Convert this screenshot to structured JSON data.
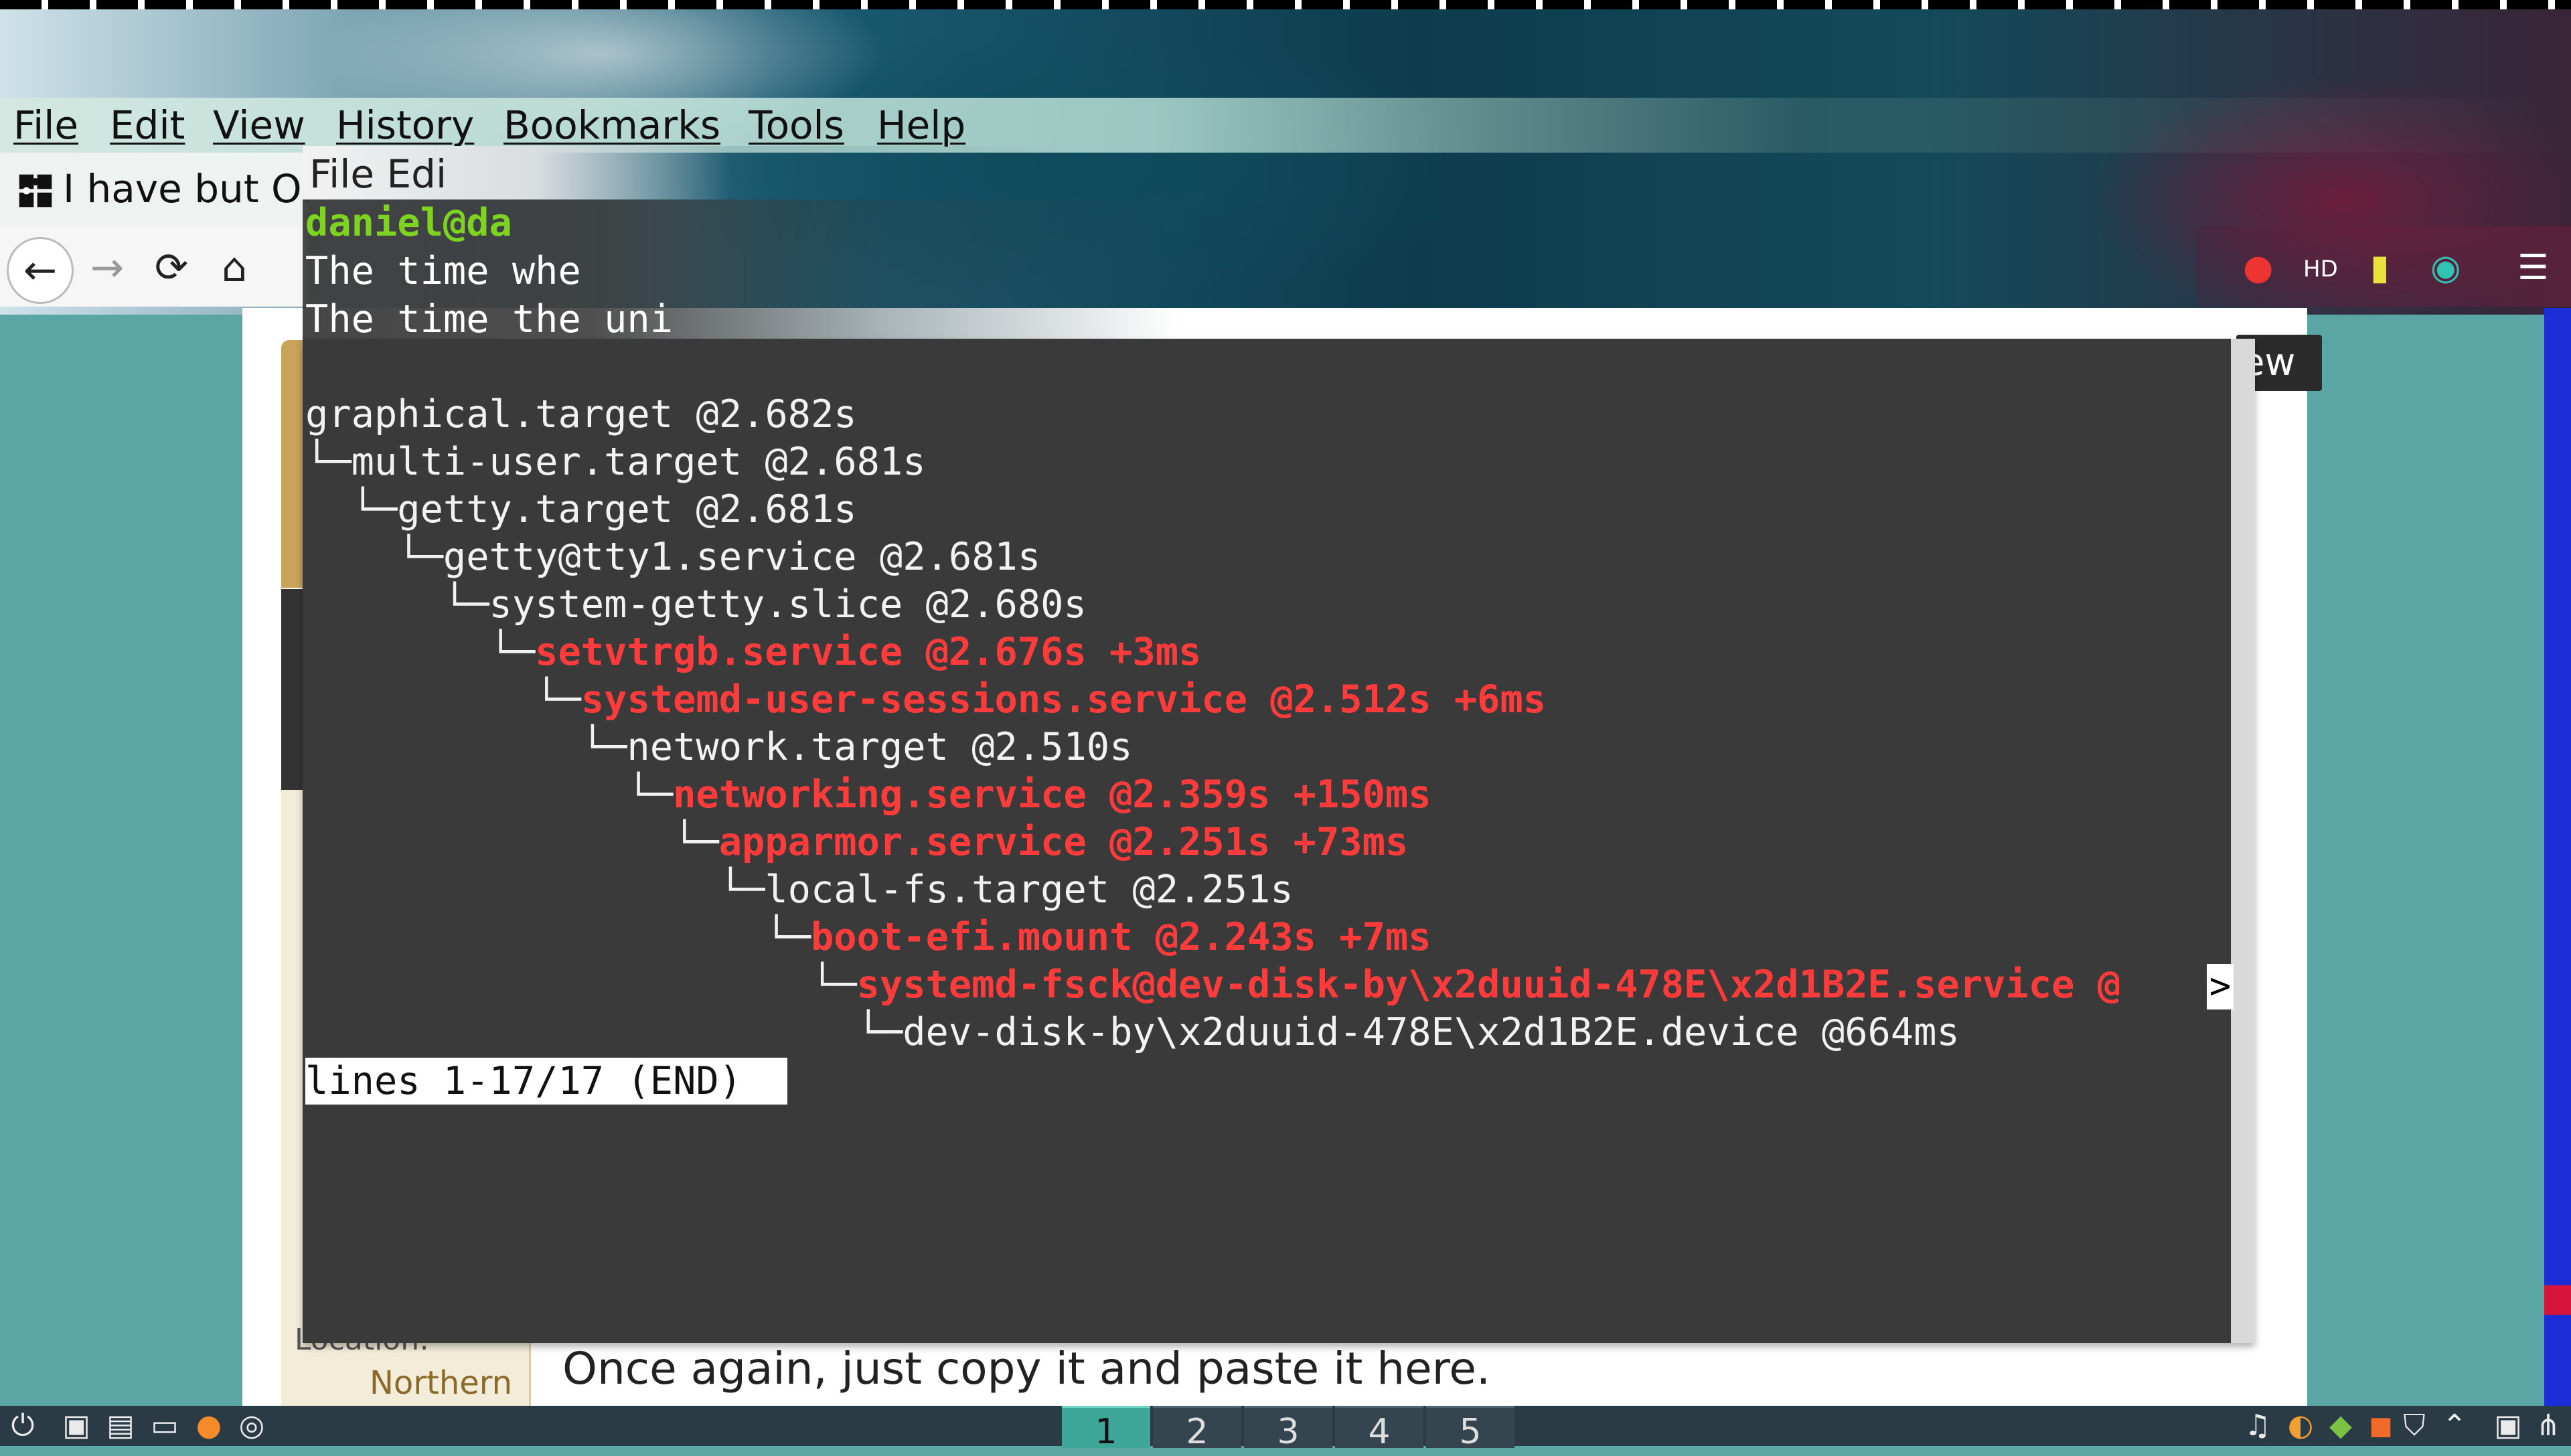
{
  "browser": {
    "menu": [
      "File",
      "Edit",
      "View",
      "History",
      "Bookmarks",
      "Tools",
      "Help"
    ],
    "tab_title": "I have but Ol",
    "new_button_label": "ew",
    "page": {
      "answer_hint": "Once again, just copy it and paste it here.",
      "location_label": "Location:",
      "location_value": "Northern"
    }
  },
  "terminal": {
    "title_menu": "File Edi",
    "prompt": "daniel@da",
    "top_lines": [
      "The time whe",
      "The time the uni"
    ],
    "lines": [
      {
        "text": "graphical.target @2.682s",
        "red": false
      },
      {
        "text": "└─multi-user.target @2.681s",
        "red": false
      },
      {
        "text": "  └─getty.target @2.681s",
        "red": false
      },
      {
        "text": "    └─getty@tty1.service @2.681s",
        "red": false
      },
      {
        "text": "      └─system-getty.slice @2.680s",
        "red": false
      },
      {
        "text": "        └─",
        "red_text": "setvtrgb.service @2.676s +3ms"
      },
      {
        "text": "          └─",
        "red_text": "systemd-user-sessions.service @2.512s +6ms"
      },
      {
        "text": "            └─network.target @2.510s",
        "red": false
      },
      {
        "text": "              └─",
        "red_text": "networking.service @2.359s +150ms"
      },
      {
        "text": "                └─",
        "red_text": "apparmor.service @2.251s +73ms"
      },
      {
        "text": "                  └─local-fs.target @2.251s",
        "red": false
      },
      {
        "text": "                    └─",
        "red_text": "boot-efi.mount @2.243s +7ms"
      },
      {
        "text": "                      └─",
        "red_text": "systemd-fsck@dev-disk-by\\x2duuid-478E\\x2d1B2E.service @"
      },
      {
        "text": "                        └─dev-disk-by\\x2duuid-478E\\x2d1B2E.device @664ms",
        "red": false
      }
    ],
    "overflow_marker": ">",
    "status": "lines 1-17/17 (END) "
  },
  "taskbar": {
    "workspaces": [
      "1",
      "2",
      "3",
      "4",
      "5"
    ],
    "active_workspace": "1"
  },
  "colors": {
    "terminal_bg": "#3a3a3a",
    "highlight_red": "#ff3b3b",
    "prompt_green": "#7ed321",
    "taskbar": "#2b3b45",
    "active_workspace": "#3fa69a"
  }
}
